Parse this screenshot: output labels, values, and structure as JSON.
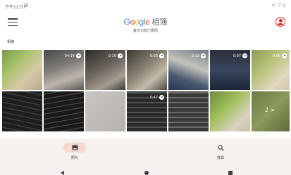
{
  "status_bar": {
    "time": "下午12:57",
    "gear_icon": "gear-icon",
    "right_icons": [
      "target-icon",
      "wifi-icon",
      "battery-icon"
    ]
  },
  "app_bar": {
    "menu_icon": "hamburger-menu-icon",
    "logo_letters": [
      "G",
      "o",
      "o",
      "g",
      "l",
      "e"
    ],
    "logo_colors": [
      "#4285F4",
      "#EA4335",
      "#FBBC05",
      "#4285F4",
      "#34A853",
      "#EA4335"
    ],
    "app_name": "相簿",
    "subtitle": "备份功能已關閉",
    "account_icon": "account-circle-icon"
  },
  "section_label": "相簿",
  "grid": {
    "tiles": [
      {
        "name": "photo-plant-1",
        "duration": ""
      },
      {
        "name": "video-1",
        "duration": "04:14"
      },
      {
        "name": "video-2",
        "duration": "0:10"
      },
      {
        "name": "video-3",
        "duration": "0:03"
      },
      {
        "name": "video-4",
        "duration": "0:13"
      },
      {
        "name": "video-5",
        "duration": "0:07"
      },
      {
        "name": "video-6",
        "duration": "0:06"
      },
      {
        "name": "photo-keyboard-1",
        "duration": ""
      },
      {
        "name": "photo-keyboard-2",
        "duration": ""
      },
      {
        "name": "photo-blank",
        "duration": ""
      },
      {
        "name": "video-keyboard",
        "duration": "5:47"
      },
      {
        "name": "photo-keyboard-3",
        "duration": ""
      },
      {
        "name": "photo-plant-2",
        "duration": ""
      },
      {
        "name": "photo-more",
        "duration": ""
      }
    ],
    "more_label": "2 >"
  },
  "bottom_nav": {
    "photos_label": "照片",
    "search_label": "搜尋",
    "photos_icon": "photo-icon",
    "search_icon": "search-icon"
  },
  "colors": {
    "accent": "#d93025",
    "nav_background": "#f6f1ee",
    "active_pill": "#f8d7cf"
  }
}
